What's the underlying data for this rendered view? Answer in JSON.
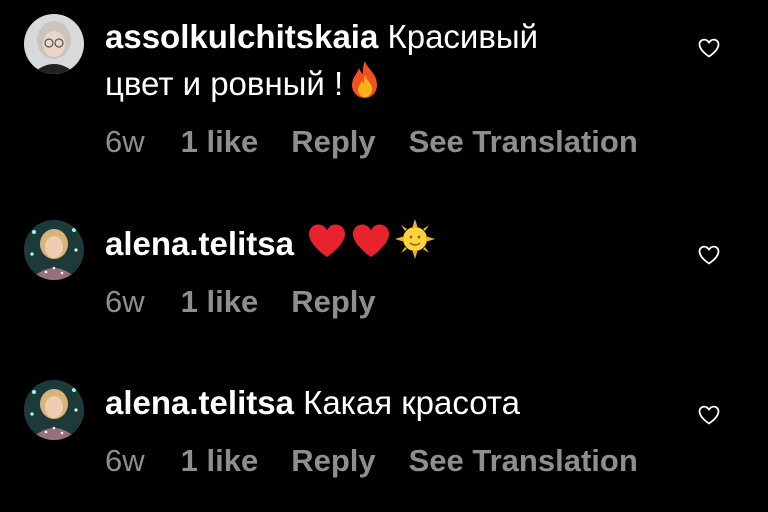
{
  "colors": {
    "background": "#000000",
    "text": "#ffffff",
    "meta": "#8e8e8e"
  },
  "comments": [
    {
      "username": "assolkulchitskaia",
      "text_line1": "Красивый",
      "text_line2": "цвет и ровный !",
      "emojis": [
        "fire"
      ],
      "time": "6w",
      "likes": "1 like",
      "reply": "Reply",
      "translate": "See Translation",
      "avatar_icon": "avatar-woman-glasses-icon",
      "like_icon": "heart-outline-icon"
    },
    {
      "username": "alena.telitsa",
      "text": "",
      "emojis": [
        "red-heart",
        "red-heart",
        "sun-with-face"
      ],
      "time": "6w",
      "likes": "1 like",
      "reply": "Reply",
      "avatar_icon": "avatar-woman-icon",
      "like_icon": "heart-outline-icon"
    },
    {
      "username": "alena.telitsa",
      "text": "Какая красота",
      "time": "6w",
      "likes": "1 like",
      "reply": "Reply",
      "translate": "See Translation",
      "avatar_icon": "avatar-woman-icon",
      "like_icon": "heart-outline-icon"
    }
  ]
}
